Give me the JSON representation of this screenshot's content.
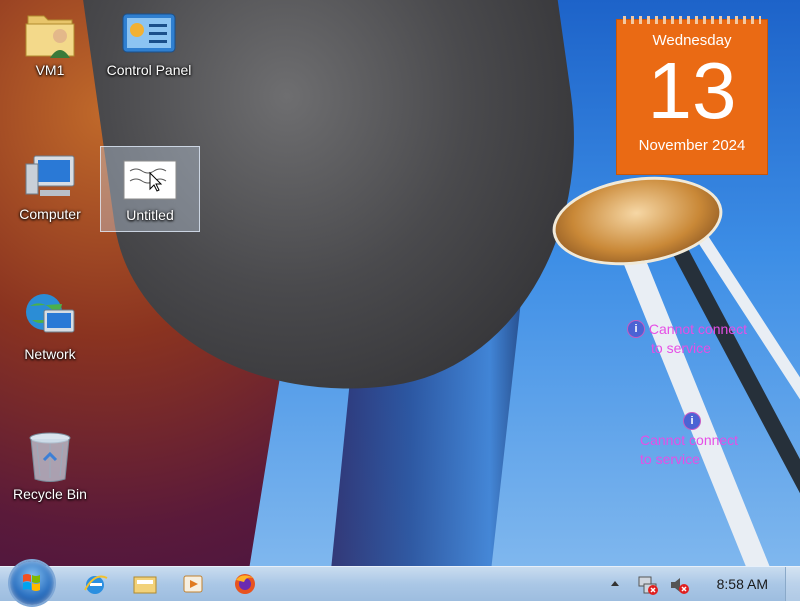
{
  "desktop_icons": [
    {
      "label": "VM1",
      "icon": "user-folder-icon"
    },
    {
      "label": "Control Panel",
      "icon": "control-panel-icon"
    },
    {
      "label": "Computer",
      "icon": "computer-icon"
    },
    {
      "label": "Untitled",
      "icon": "image-file-icon",
      "selected": true
    },
    {
      "label": "Network",
      "icon": "network-icon"
    },
    {
      "label": "Recycle Bin",
      "icon": "recycle-bin-icon"
    }
  ],
  "calendar": {
    "day": "Wednesday",
    "date": "13",
    "month_year": "November 2024",
    "color": "#ea6a14"
  },
  "notices": [
    {
      "line1": "Cannot connect",
      "line2": "to service"
    },
    {
      "line1": "Cannot connect",
      "line2": "to service"
    }
  ],
  "taskbar": {
    "pinned": [
      "internet-explorer-icon",
      "file-explorer-icon",
      "media-player-icon",
      "firefox-icon"
    ],
    "tray_icons": [
      "show-hidden-icons-arrow",
      "network-disconnected-icon",
      "volume-muted-icon"
    ],
    "clock": "8:58 AM"
  }
}
